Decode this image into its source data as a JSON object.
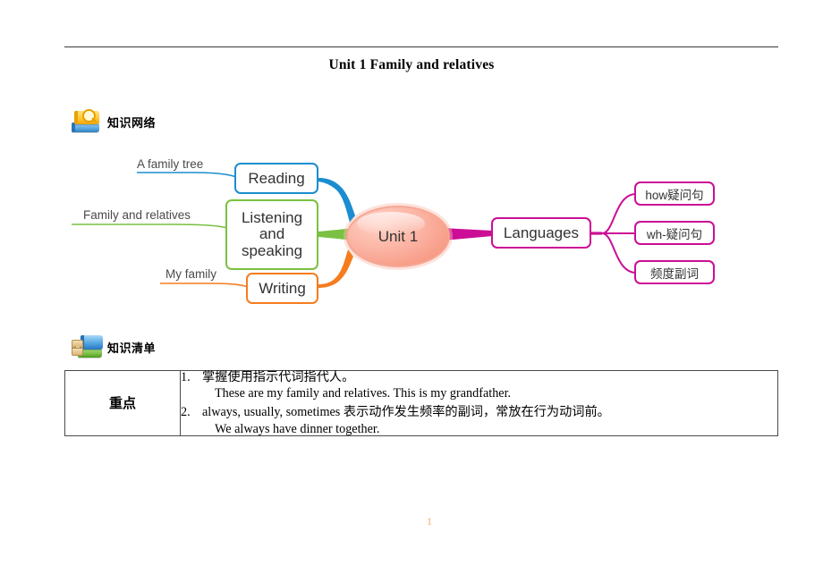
{
  "document": {
    "title": "Unit 1 Family and relatives",
    "page_number": "1"
  },
  "sections": [
    {
      "icon": "books-magnifier-icon",
      "label": "知识网络"
    },
    {
      "icon": "books-hourglass-icon",
      "label": "知识清单"
    }
  ],
  "mindmap": {
    "center": {
      "label": "Unit 1",
      "color": "#f79b86"
    },
    "branches": [
      {
        "node": "Reading",
        "leaf_label": "A family tree",
        "color": "#1b8dd0"
      },
      {
        "node": "Listening and speaking",
        "leaf_label": "Family and relatives",
        "color": "#7ac143"
      },
      {
        "node": "Writing",
        "leaf_label": "My family",
        "color": "#f57c1f"
      },
      {
        "node": "Languages",
        "color": "#cc0e96",
        "children": [
          "how疑问句",
          "wh-疑问句",
          "频度副词"
        ]
      }
    ],
    "node_labels": {
      "reading": "Reading",
      "listening_line1": "Listening",
      "listening_line2": "and",
      "listening_line3": "speaking",
      "writing": "Writing",
      "languages": "Languages",
      "how": "how疑问句",
      "wh": "wh-疑问句",
      "freq": "频度副词"
    },
    "leaf_labels": {
      "family_tree": "A family tree",
      "family_relatives": "Family and relatives",
      "my_family": "My family"
    }
  },
  "table": {
    "rows": [
      {
        "key": "重点",
        "items": [
          {
            "num": "1.",
            "text": "掌握使用指示代词指代人。",
            "example": "These are my family and relatives. This is my grandfather."
          },
          {
            "num": "2.",
            "text": "always, usually, sometimes  表示动作发生频率的副词，常放在行为动词前。",
            "example": "We always have dinner together."
          }
        ]
      }
    ]
  }
}
